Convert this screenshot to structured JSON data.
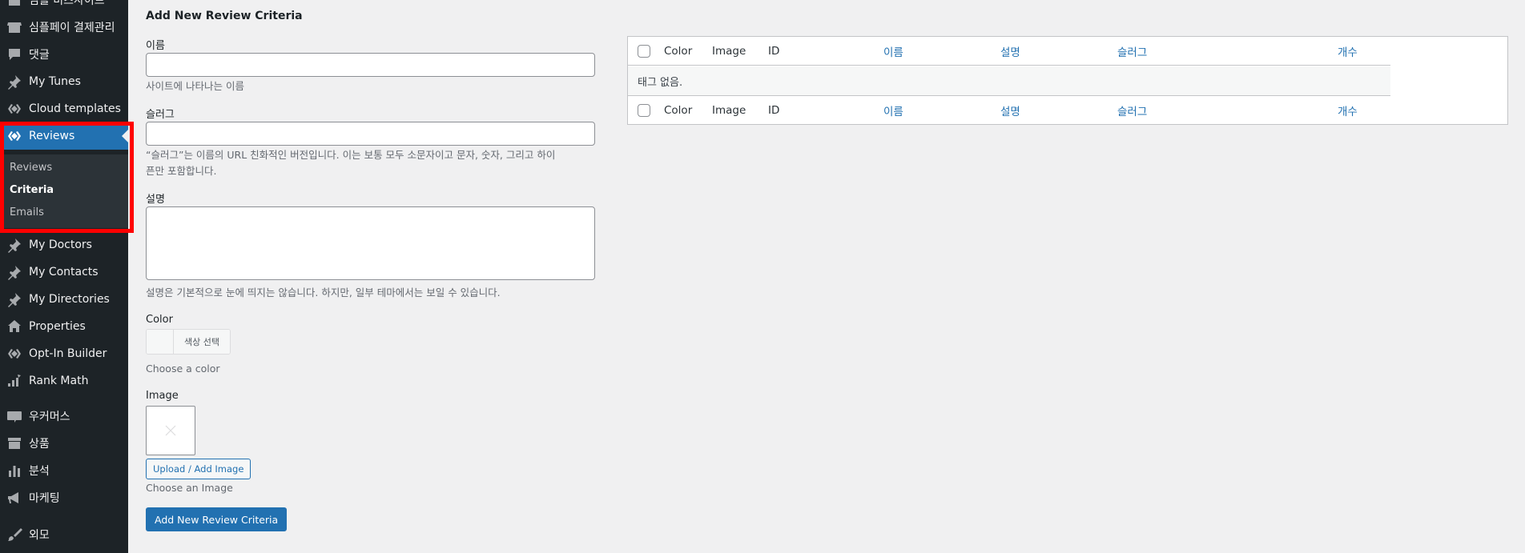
{
  "sidebar": {
    "items": [
      {
        "label": "심플 비즈사이트",
        "icon": "store-icon"
      },
      {
        "label": "심플페이 결제관리",
        "icon": "store-icon"
      },
      {
        "label": "댓글",
        "icon": "comment-icon"
      },
      {
        "label": "My Tunes",
        "icon": "pin-icon"
      },
      {
        "label": "Cloud templates",
        "icon": "elementor-icon"
      },
      {
        "label": "Reviews",
        "icon": "elementor-icon"
      },
      {
        "label": "My Doctors",
        "icon": "pin-icon"
      },
      {
        "label": "My Contacts",
        "icon": "pin-icon"
      },
      {
        "label": "My Directories",
        "icon": "pin-icon"
      },
      {
        "label": "Properties",
        "icon": "properties-icon"
      },
      {
        "label": "Opt-In Builder",
        "icon": "elementor-icon"
      },
      {
        "label": "Rank Math",
        "icon": "rankmath-icon"
      },
      {
        "label": "우커머스",
        "icon": "woo-icon"
      },
      {
        "label": "상품",
        "icon": "archive-icon"
      },
      {
        "label": "분석",
        "icon": "chart-icon"
      },
      {
        "label": "마케팅",
        "icon": "megaphone-icon"
      },
      {
        "label": "외모",
        "icon": "brush-icon"
      }
    ],
    "submenu": [
      "Reviews",
      "Criteria",
      "Emails"
    ],
    "active_sub": "Criteria",
    "current_item": "Reviews",
    "accent_color": "#2271b1",
    "highlight_color": "#ff0000"
  },
  "form": {
    "heading": "Add New Review Criteria",
    "name_label": "이름",
    "name_value": "",
    "name_desc": "사이트에 나타나는 이름",
    "slug_label": "슬러그",
    "slug_value": "",
    "slug_desc_1": "“슬러그”는 이름의 URL 친화적인 버전입니다. 이는 보통 모두 소문자이고 문자, 숫자, 그리고 하이",
    "slug_desc_2": "픈만 포함합니다.",
    "desc_label": "설명",
    "desc_value": "",
    "desc_desc": "설명은 기본적으로 눈에 띄지는 않습니다. 하지만, 일부 테마에서는 보일 수 있습니다.",
    "color_label": "Color",
    "color_button": "색상 선택",
    "color_desc": "Choose a color",
    "image_label": "Image",
    "upload_button": "Upload / Add Image",
    "image_desc": "Choose an Image",
    "submit_button": "Add New Review Criteria"
  },
  "table": {
    "columns": [
      "Color",
      "Image",
      "ID",
      "이름",
      "설명",
      "슬러그",
      "개수"
    ],
    "empty_message": "태그 없음."
  }
}
